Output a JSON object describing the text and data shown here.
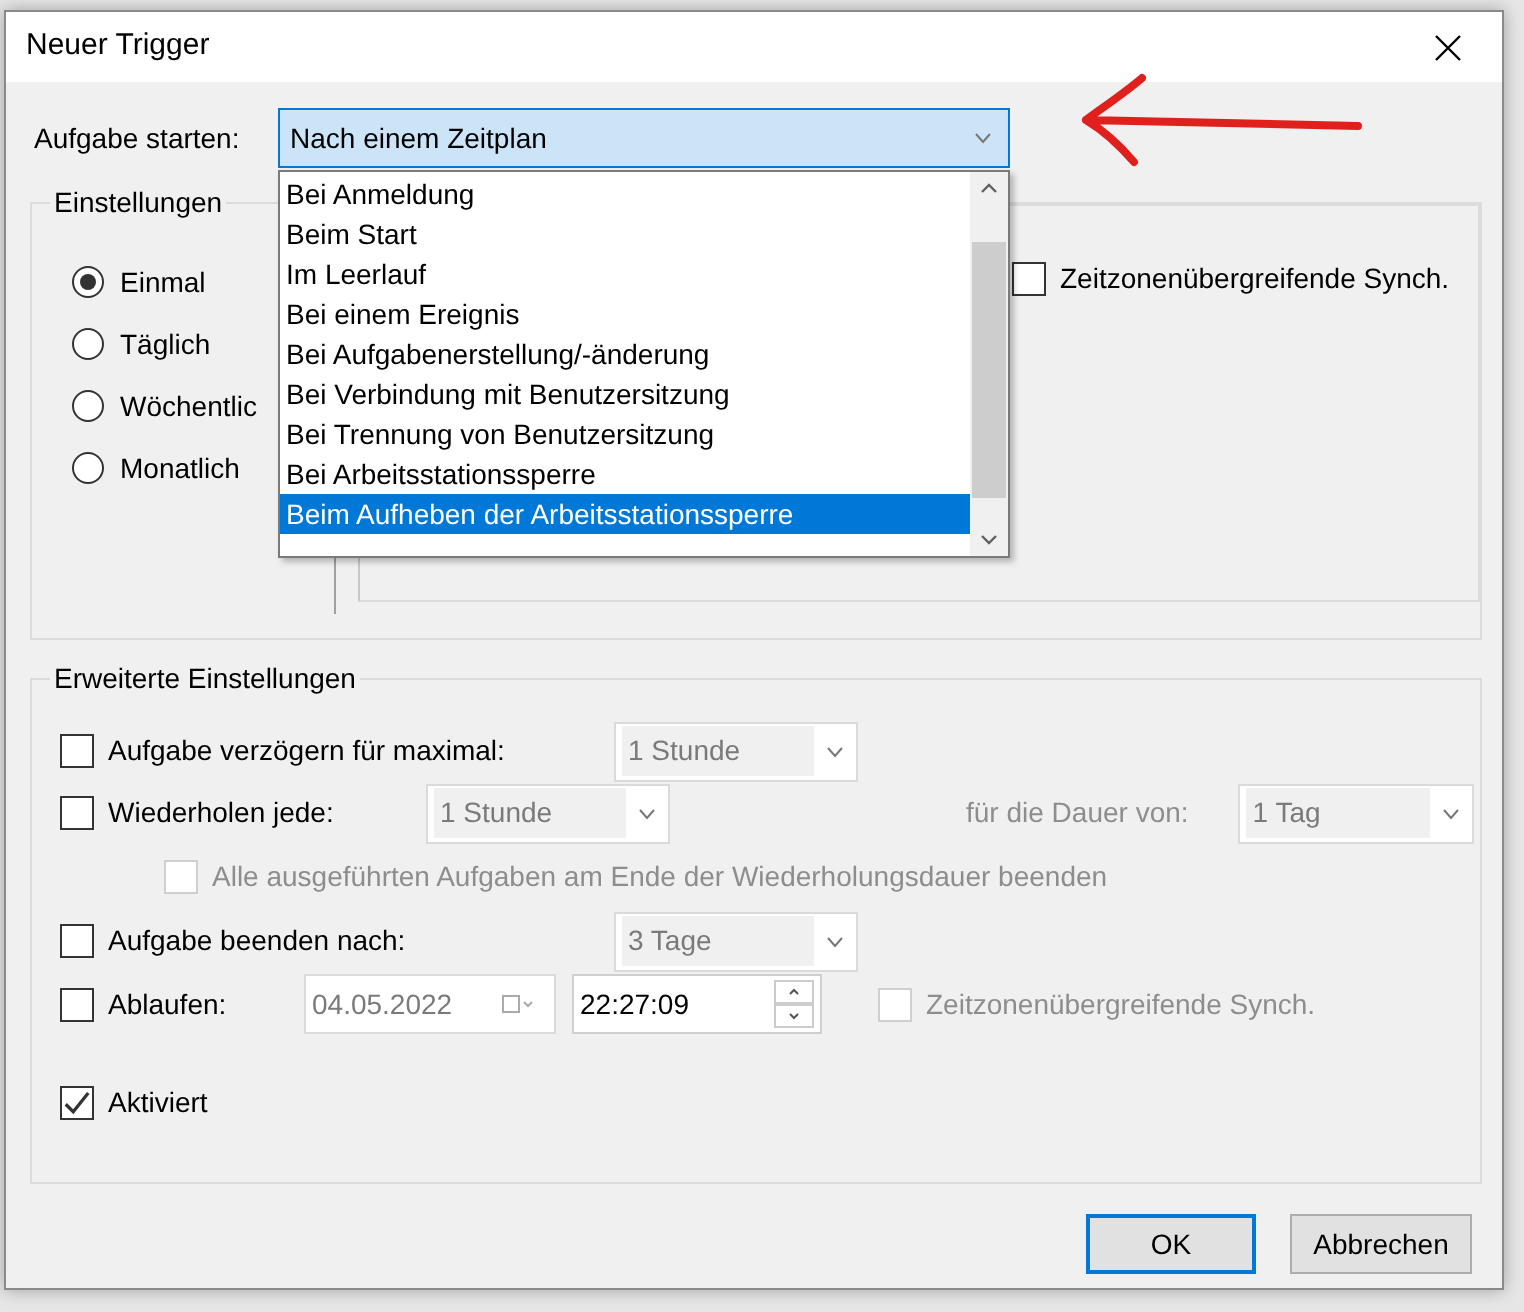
{
  "window": {
    "title": "Neuer Trigger"
  },
  "start": {
    "label": "Aufgabe starten:",
    "value": "Nach einem Zeitplan",
    "expanded": true,
    "options": [
      {
        "label": "Bei Anmeldung",
        "selected": false
      },
      {
        "label": "Beim Start",
        "selected": false
      },
      {
        "label": "Im Leerlauf",
        "selected": false
      },
      {
        "label": "Bei einem Ereignis",
        "selected": false
      },
      {
        "label": "Bei Aufgabenerstellung/-änderung",
        "selected": false
      },
      {
        "label": "Bei Verbindung mit Benutzersitzung",
        "selected": false
      },
      {
        "label": "Bei Trennung von Benutzersitzung",
        "selected": false
      },
      {
        "label": "Bei Arbeitsstationssperre",
        "selected": false
      },
      {
        "label": "Beim Aufheben der Arbeitsstationssperre",
        "selected": true
      }
    ]
  },
  "settings": {
    "title": "Einstellungen",
    "schedule": [
      {
        "label": "Einmal",
        "selected": true
      },
      {
        "label": "Täglich",
        "selected": false
      },
      {
        "label": "Wöchentlic",
        "selected": false
      },
      {
        "label": "Monatlich",
        "selected": false
      }
    ],
    "sync": {
      "label": "Zeitzonenübergreifende Synch.",
      "checked": false
    }
  },
  "advanced": {
    "title": "Erweiterte Einstellungen",
    "rows": [
      {
        "kind": "delay",
        "checkbox": {
          "label": "Aufgabe verzögern für maximal:",
          "checked": false
        },
        "controls": [
          {
            "kind": "combo",
            "text": "1 Stunde",
            "disabled": true
          }
        ]
      },
      {
        "kind": "repeat",
        "checkbox": {
          "label": "Wiederholen jede:",
          "checked": false
        },
        "controls": [
          {
            "kind": "combo",
            "text": "1 Stunde",
            "disabled": true
          },
          {
            "kind": "label",
            "text": "für die Dauer von:",
            "disabled": true
          },
          {
            "kind": "combo",
            "text": "1 Tag",
            "disabled": true
          }
        ]
      },
      {
        "kind": "sub",
        "checkbox": {
          "label": "Alle ausgeführten Aufgaben am Ende der Wiederholungsdauer beenden",
          "checked": false,
          "disabled": true
        },
        "controls": []
      },
      {
        "kind": "stop",
        "checkbox": {
          "label": "Aufgabe beenden nach:",
          "checked": false
        },
        "controls": [
          {
            "kind": "combo",
            "text": "3 Tage",
            "disabled": true
          }
        ]
      },
      {
        "kind": "expire",
        "checkbox": {
          "label": "Ablaufen:",
          "checked": false
        },
        "controls": [
          {
            "kind": "date",
            "text": "04.05.2022",
            "disabled": true
          },
          {
            "kind": "time",
            "text": "22:27:09",
            "disabled": false
          },
          {
            "kind": "checkbox",
            "text": "Zeitzonenübergreifende Synch.",
            "disabled": true
          }
        ]
      },
      {
        "kind": "enable",
        "checkbox": {
          "label": "Aktiviert",
          "checked": true
        },
        "controls": []
      }
    ]
  },
  "buttons": [
    {
      "label": "OK",
      "default": true
    },
    {
      "label": "Abbrechen",
      "default": false
    }
  ]
}
